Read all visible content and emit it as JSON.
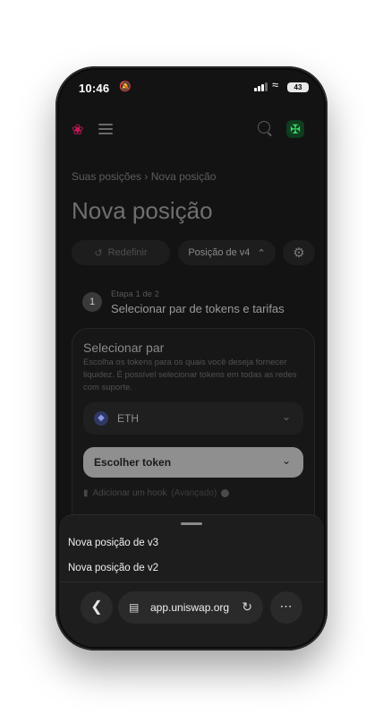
{
  "status_bar": {
    "time": "10:46",
    "battery": "43"
  },
  "breadcrumb": {
    "parent": "Suas posições",
    "separator": "›",
    "current": "Nova posição"
  },
  "page_title": "Nova posição",
  "toolbar": {
    "reset_label": "Redefinir",
    "version_label": "Posição de v4"
  },
  "step": {
    "number": "1",
    "label": "Etapa 1 de 2",
    "title": "Selecionar par de tokens e tarifas"
  },
  "pair_card": {
    "title": "Selecionar par",
    "description": "Escolha os tokens para os quais você deseja fornecer liquidez. É possível selecionar tokens em todas as redes com suporte.",
    "token1": "ETH",
    "token2_placeholder": "Escolher token",
    "hook_label": "Adicionar um hook",
    "hook_advanced": "(Avançado)"
  },
  "sheet": {
    "options": [
      "Nova posição de v3",
      "Nova posição de v2"
    ]
  },
  "browser": {
    "url": "app.uniswap.org"
  },
  "colors": {
    "brand": "#c2185b",
    "eth": "#627eea"
  }
}
